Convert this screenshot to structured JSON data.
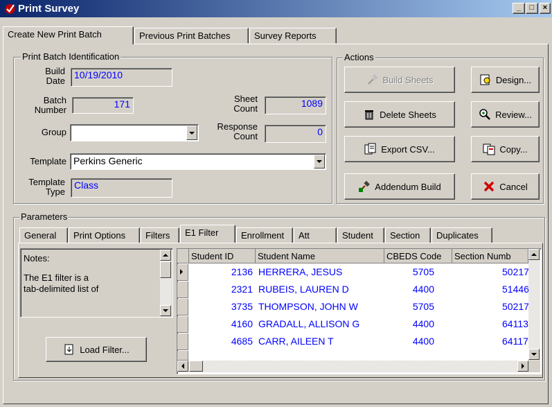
{
  "window": {
    "title": "Print Survey",
    "minimize": "_",
    "maximize": "□",
    "close": "×"
  },
  "main_tabs": [
    {
      "label": "Create New Print Batch"
    },
    {
      "label": "Previous Print Batches"
    },
    {
      "label": "Survey Reports"
    }
  ],
  "identification": {
    "group_label": "Print Batch Identification",
    "build_date_label_1": "Build",
    "build_date_label_2": "Date",
    "build_date": "10/19/2010",
    "batch_number_label_1": "Batch",
    "batch_number_label_2": "Number",
    "batch_number": "171",
    "sheet_count_label_1": "Sheet",
    "sheet_count_label_2": "Count",
    "sheet_count": "1089",
    "response_count_label_1": "Response",
    "response_count_label_2": "Count",
    "response_count": "0",
    "group_field_label": "Group",
    "group_value": "",
    "template_label": "Template",
    "template_value": "Perkins Generic",
    "template_type_label_1": "Template",
    "template_type_label_2": "Type",
    "template_type": "Class"
  },
  "actions": {
    "group_label": "Actions",
    "build_sheets": "Build Sheets",
    "design": "Design...",
    "delete_sheets": "Delete Sheets",
    "review": "Review...",
    "export_csv": "Export CSV...",
    "copy": "Copy...",
    "addendum_build": "Addendum Build",
    "cancel": "Cancel"
  },
  "parameters": {
    "group_label": "Parameters",
    "tabs": [
      "General",
      "Print Options",
      "Filters",
      "E1 Filter",
      "Enrollment",
      "Att",
      "Student",
      "Section",
      "Duplicates"
    ],
    "notes_text_1": "Notes:",
    "notes_text_2": "The E1 filter is a",
    "notes_text_3": "tab-delimited list of",
    "load_filter": "Load Filter..."
  },
  "grid": {
    "columns": [
      "Student ID",
      "Student Name",
      "CBEDS Code",
      "Section Numb"
    ],
    "rows": [
      [
        "2136",
        "HERRERA, JESUS",
        "5705",
        "50217"
      ],
      [
        "2321",
        "RUBEIS, LAUREN D",
        "4400",
        "51446"
      ],
      [
        "3735",
        "THOMPSON, JOHN W",
        "5705",
        "50217"
      ],
      [
        "4160",
        "GRADALL, ALLISON G",
        "4400",
        "64113"
      ],
      [
        "4685",
        "CARR, AILEEN T",
        "4400",
        "64117"
      ]
    ]
  },
  "colors": {
    "titlebar": "#0a246a",
    "face": "#d4d0c8",
    "value_text": "#0000ff"
  }
}
